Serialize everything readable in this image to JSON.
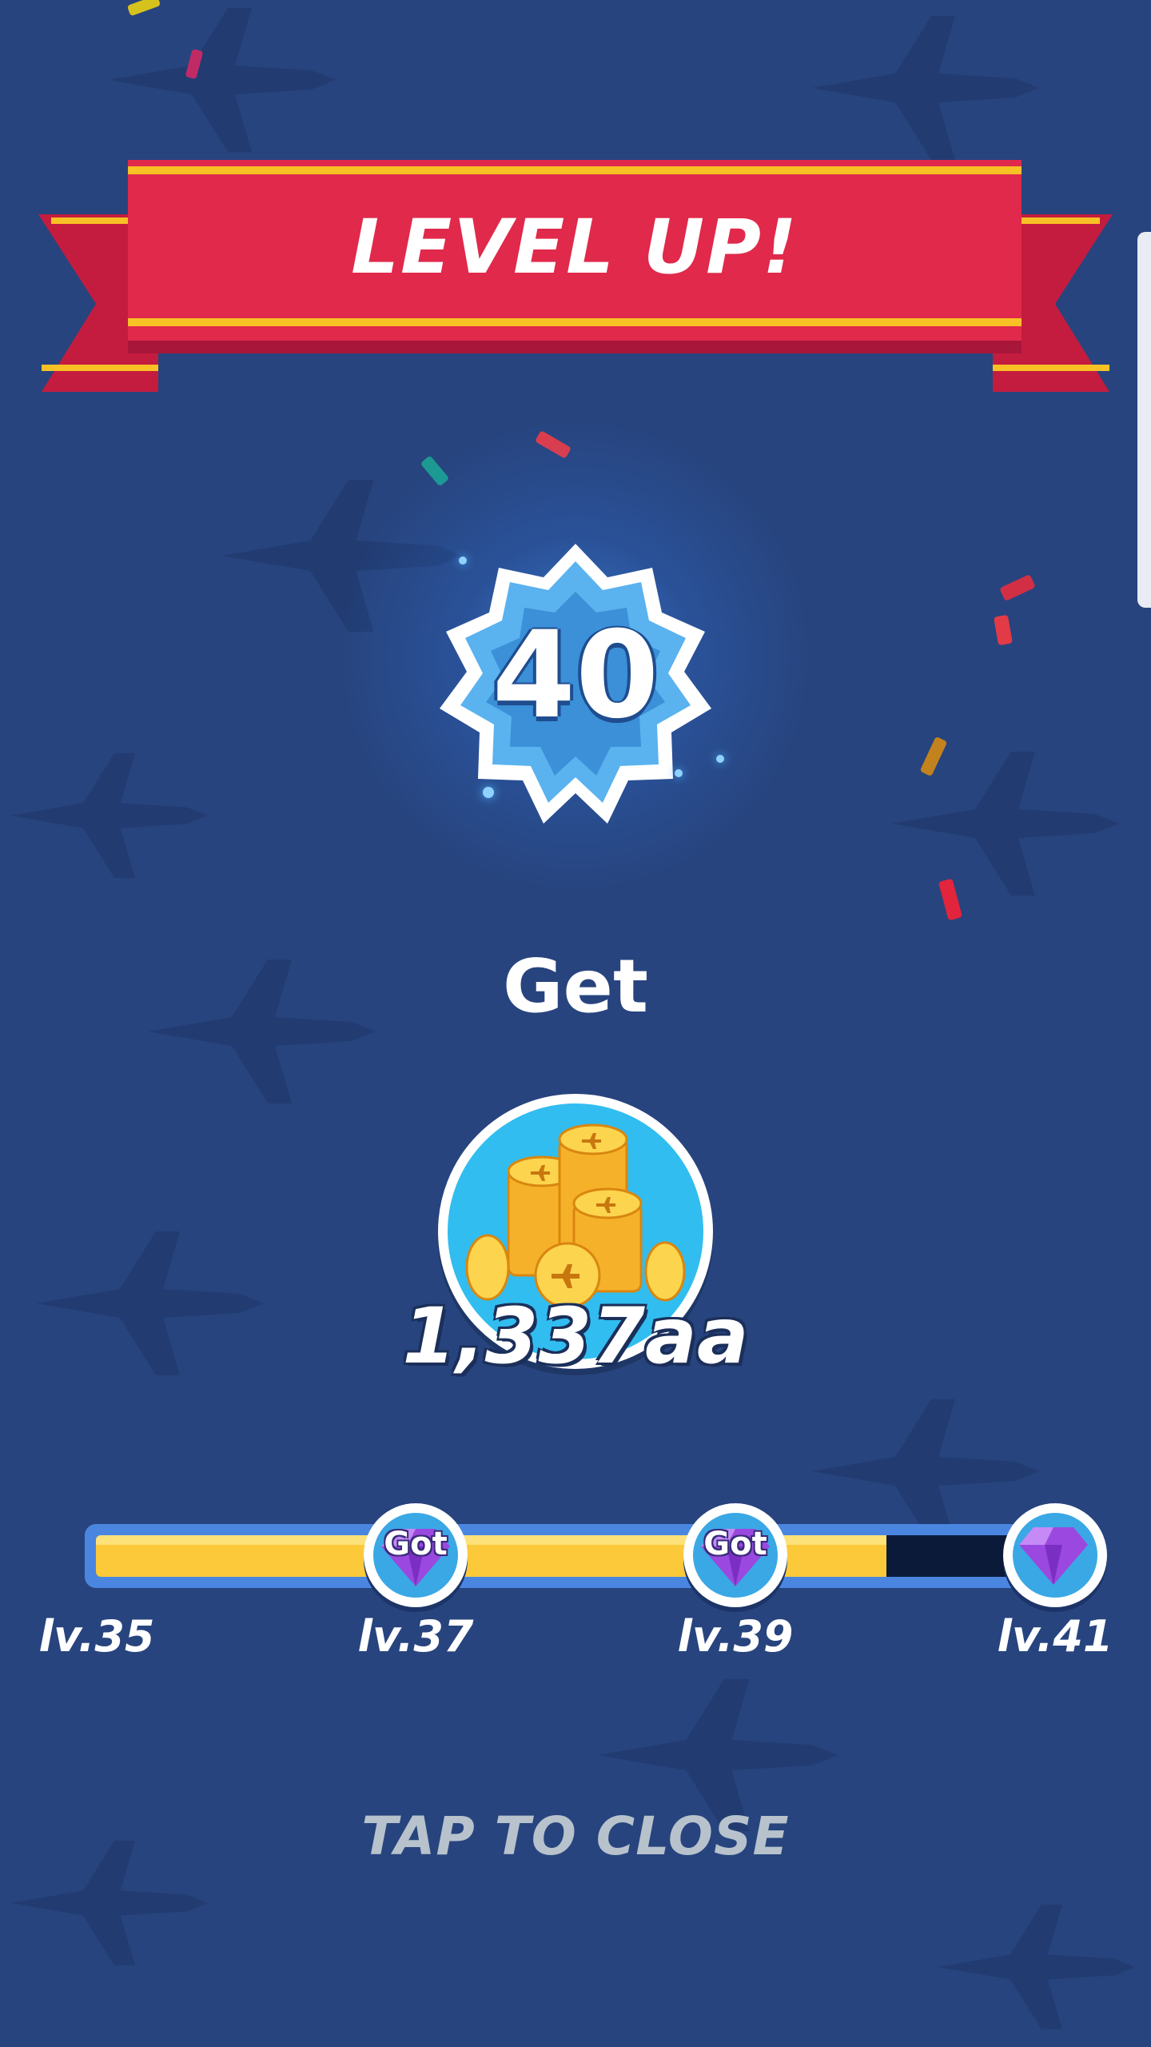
{
  "banner": {
    "title": "LEVEL UP!"
  },
  "level_badge": {
    "level": "40"
  },
  "reward": {
    "heading": "Get",
    "amount": "1,337aa",
    "icon": "coin-stack-icon"
  },
  "progress": {
    "fill_fraction": 0.83,
    "milestones": [
      {
        "level_label": "lv.37",
        "status": "Got",
        "icon": "gem-icon"
      },
      {
        "level_label": "lv.39",
        "status": "Got",
        "icon": "gem-icon"
      },
      {
        "level_label": "lv.41",
        "status": "",
        "icon": "gem-icon"
      }
    ],
    "start_label": "lv.35"
  },
  "close": {
    "label": "TAP TO CLOSE"
  },
  "colors": {
    "background": "#27447e",
    "banner_red": "#e0294b",
    "banner_stripe": "#f8c125",
    "progress_fill": "#fcc93a",
    "gem_purple": "#9b48e0"
  }
}
